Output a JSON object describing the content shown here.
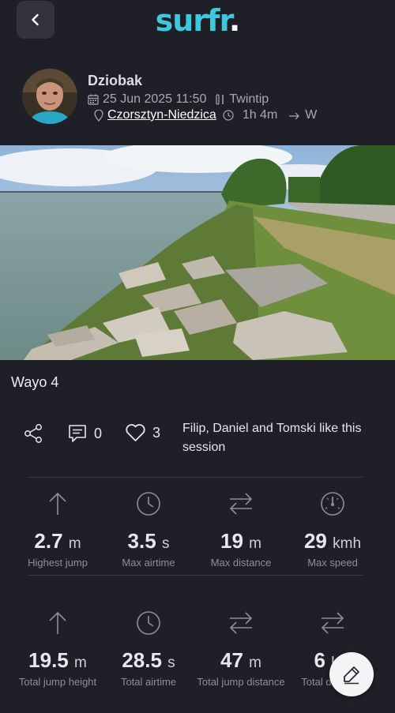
{
  "app": {
    "logo_text": "surfr",
    "logo_dot": "."
  },
  "header": {
    "back_icon": "chevron-left-icon"
  },
  "user": {
    "name": "Dziobak",
    "date": "25 Jun 2025 11:50",
    "discipline": "Twintip",
    "location": "Czorsztyn-Niedzica",
    "duration": "1h 4m",
    "wind_direction": "W"
  },
  "session": {
    "title": "Wayo 4"
  },
  "social": {
    "comments_count": "0",
    "likes_count": "3",
    "likes_text": "Filip, Daniel and Tomski like this session"
  },
  "stats_row1": [
    {
      "icon": "arrow-up-icon",
      "value": "2.7",
      "unit": "m",
      "label": "Highest jump"
    },
    {
      "icon": "clock-icon",
      "value": "3.5",
      "unit": "s",
      "label": "Max airtime"
    },
    {
      "icon": "swap-arrows-icon",
      "value": "19",
      "unit": "m",
      "label": "Max distance"
    },
    {
      "icon": "speedometer-icon",
      "value": "29",
      "unit": "kmh",
      "label": "Max speed"
    }
  ],
  "stats_row2": [
    {
      "icon": "arrow-up-icon",
      "value": "19.5",
      "unit": "m",
      "label": "Total jump height"
    },
    {
      "icon": "clock-icon",
      "value": "28.5",
      "unit": "s",
      "label": "Total airtime"
    },
    {
      "icon": "swap-arrows-icon",
      "value": "47",
      "unit": "m",
      "label": "Total jump distance"
    },
    {
      "icon": "swap-arrows-icon",
      "value": "6",
      "unit": "km",
      "label": "Total distance"
    }
  ],
  "colors": {
    "background": "#1f1f27",
    "brand": "#3fc7dc",
    "link": "#ffffff"
  }
}
